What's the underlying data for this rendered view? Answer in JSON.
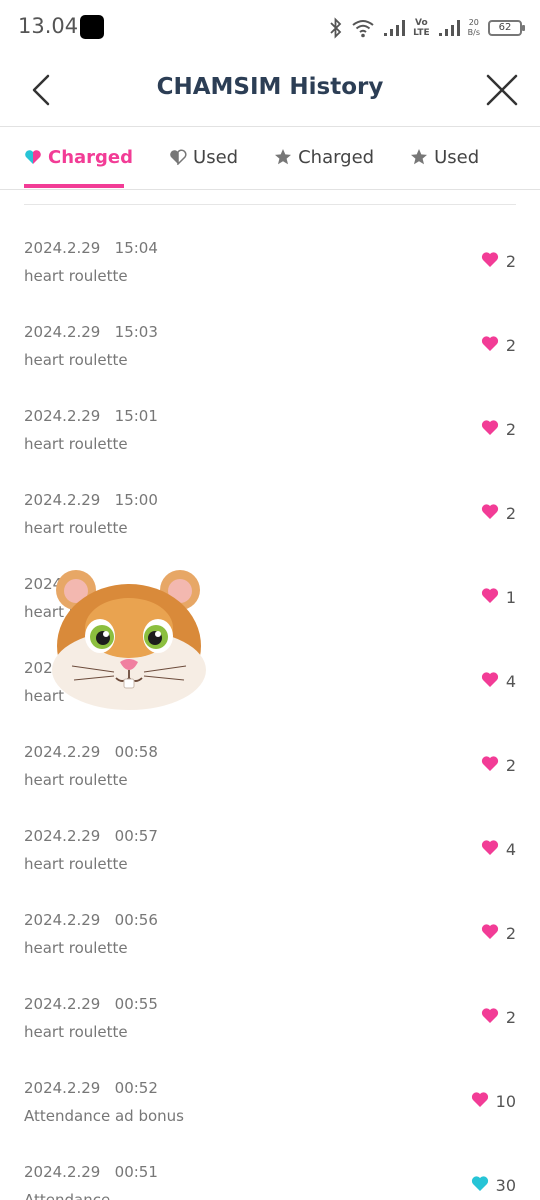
{
  "status": {
    "time": "13.04",
    "volte_top": "Vo",
    "volte_bottom": "LTE",
    "speed_value": "20",
    "speed_unit": "B/s",
    "battery": "62"
  },
  "header": {
    "title": "CHAMSIM History"
  },
  "tabs": [
    {
      "label": "Charged",
      "icon": "heart-charged-icon",
      "active": true
    },
    {
      "label": "Used",
      "icon": "heart-used-icon",
      "active": false
    },
    {
      "label": "Charged",
      "icon": "star-icon",
      "active": false
    },
    {
      "label": "Used",
      "icon": "star-icon",
      "active": false
    }
  ],
  "colors": {
    "accent": "#f23c96",
    "heart_pink": "#f23c96",
    "heart_cyan": "#27c4d6",
    "title": "#2c3e55"
  },
  "rows": [
    {
      "date": "2024.2.29",
      "time": "15:04",
      "desc": "heart roulette",
      "amount": "2",
      "heart": "pink"
    },
    {
      "date": "2024.2.29",
      "time": "15:03",
      "desc": "heart roulette",
      "amount": "2",
      "heart": "pink"
    },
    {
      "date": "2024.2.29",
      "time": "15:01",
      "desc": "heart roulette",
      "amount": "2",
      "heart": "pink"
    },
    {
      "date": "2024.2.29",
      "time": "15:00",
      "desc": "heart roulette",
      "amount": "2",
      "heart": "pink"
    },
    {
      "date": "2024.",
      "time": "1",
      "desc": "heart r",
      "amount": "1",
      "heart": "pink"
    },
    {
      "date": "2024",
      "time": "",
      "desc": "heart",
      "amount": "4",
      "heart": "pink"
    },
    {
      "date": "2024.2.29",
      "time": "00:58",
      "desc": "heart roulette",
      "amount": "2",
      "heart": "pink"
    },
    {
      "date": "2024.2.29",
      "time": "00:57",
      "desc": "heart roulette",
      "amount": "4",
      "heart": "pink"
    },
    {
      "date": "2024.2.29",
      "time": "00:56",
      "desc": "heart roulette",
      "amount": "2",
      "heart": "pink"
    },
    {
      "date": "2024.2.29",
      "time": "00:55",
      "desc": "heart roulette",
      "amount": "2",
      "heart": "pink"
    },
    {
      "date": "2024.2.29",
      "time": "00:52",
      "desc": "Attendance ad bonus",
      "amount": "10",
      "heart": "pink"
    },
    {
      "date": "2024.2.29",
      "time": "00:51",
      "desc": "Attendance",
      "amount": "30",
      "heart": "cyan"
    }
  ]
}
